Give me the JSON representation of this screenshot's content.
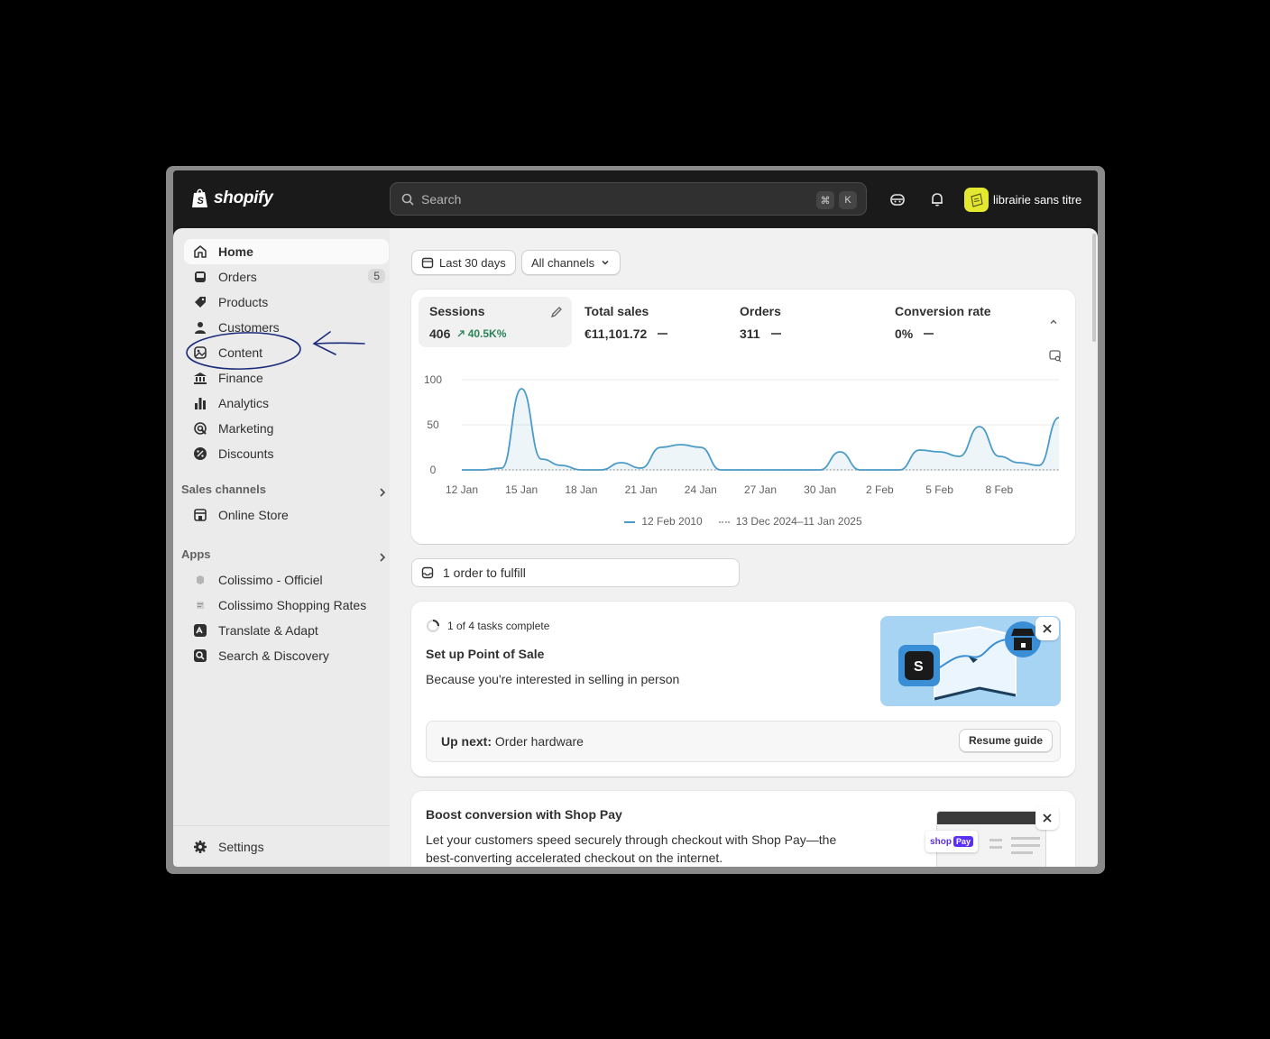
{
  "header": {
    "brand": "shopify",
    "search_placeholder": "Search",
    "shortcut_keys": [
      "⌘",
      "K"
    ],
    "store_name": "librairie sans titre"
  },
  "sidebar": {
    "items": [
      {
        "label": "Home",
        "icon": "home-icon"
      },
      {
        "label": "Orders",
        "icon": "inbox-icon",
        "badge": "5"
      },
      {
        "label": "Products",
        "icon": "tag-icon"
      },
      {
        "label": "Customers",
        "icon": "person-icon"
      },
      {
        "label": "Content",
        "icon": "image-icon"
      },
      {
        "label": "Finance",
        "icon": "bank-icon"
      },
      {
        "label": "Analytics",
        "icon": "bar-chart-icon"
      },
      {
        "label": "Marketing",
        "icon": "target-icon"
      },
      {
        "label": "Discounts",
        "icon": "discount-icon"
      }
    ],
    "sales_channels_heading": "Sales channels",
    "sales_channels": [
      {
        "label": "Online Store",
        "icon": "store-icon"
      }
    ],
    "apps_heading": "Apps",
    "apps": [
      {
        "label": "Colissimo - Officiel"
      },
      {
        "label": "Colissimo Shopping Rates"
      },
      {
        "label": "Translate & Adapt"
      },
      {
        "label": "Search & Discovery"
      }
    ],
    "settings": "Settings"
  },
  "filters": {
    "date_range": "Last 30 days",
    "channels": "All channels"
  },
  "metrics": [
    {
      "label": "Sessions",
      "value": "406",
      "change": "40.5K%"
    },
    {
      "label": "Total sales",
      "value": "€11,101.72"
    },
    {
      "label": "Orders",
      "value": "311"
    },
    {
      "label": "Conversion rate",
      "value": "0%"
    }
  ],
  "chart_data": {
    "type": "line",
    "x": [
      "12 Jan",
      "13 Jan",
      "14 Jan",
      "15 Jan",
      "16 Jan",
      "17 Jan",
      "18 Jan",
      "19 Jan",
      "20 Jan",
      "21 Jan",
      "22 Jan",
      "23 Jan",
      "24 Jan",
      "25 Jan",
      "26 Jan",
      "27 Jan",
      "28 Jan",
      "29 Jan",
      "30 Jan",
      "31 Jan",
      "1 Feb",
      "2 Feb",
      "3 Feb",
      "4 Feb",
      "5 Feb",
      "6 Feb",
      "7 Feb",
      "8 Feb",
      "9 Feb",
      "10 Feb",
      "11 Feb"
    ],
    "tick_labels": [
      "12 Jan",
      "15 Jan",
      "18 Jan",
      "21 Jan",
      "24 Jan",
      "27 Jan",
      "30 Jan",
      "2 Feb",
      "5 Feb",
      "8 Feb"
    ],
    "y_ticks": [
      "100",
      "50",
      "0"
    ],
    "ylim": [
      0,
      100
    ],
    "series": [
      {
        "name": "12 Feb 2010",
        "color": "#4b9bc9",
        "values": [
          0,
          0,
          2,
          90,
          12,
          5,
          0,
          0,
          8,
          2,
          25,
          28,
          25,
          0,
          0,
          0,
          0,
          0,
          0,
          20,
          0,
          0,
          0,
          22,
          20,
          15,
          48,
          15,
          8,
          5,
          58
        ]
      },
      {
        "name": "13 Dec 2024–11 Jan 2025",
        "color": "#a9a9a9",
        "values": [
          0,
          0,
          0,
          0,
          0,
          0,
          0,
          0,
          0,
          0,
          0,
          0,
          0,
          0,
          0,
          0,
          0,
          0,
          0,
          0,
          0,
          0,
          0,
          0,
          0,
          0,
          0,
          0,
          0,
          0,
          0
        ]
      }
    ],
    "grid": true
  },
  "fulfill": "1 order to fulfill",
  "pos_card": {
    "progress": "1 of 4 tasks complete",
    "title": "Set up Point of Sale",
    "description": "Because you're interested in selling in person",
    "up_next_label": "Up next:",
    "up_next_value": "Order hardware",
    "button": "Resume guide"
  },
  "shoppay_card": {
    "title": "Boost conversion with Shop Pay",
    "description": "Let your customers speed securely through checkout with Shop Pay—the best-converting accelerated checkout on the internet.",
    "badge": "shop Pay"
  },
  "annotation": {
    "note": "hand-drawn circle around Content with arrow"
  }
}
